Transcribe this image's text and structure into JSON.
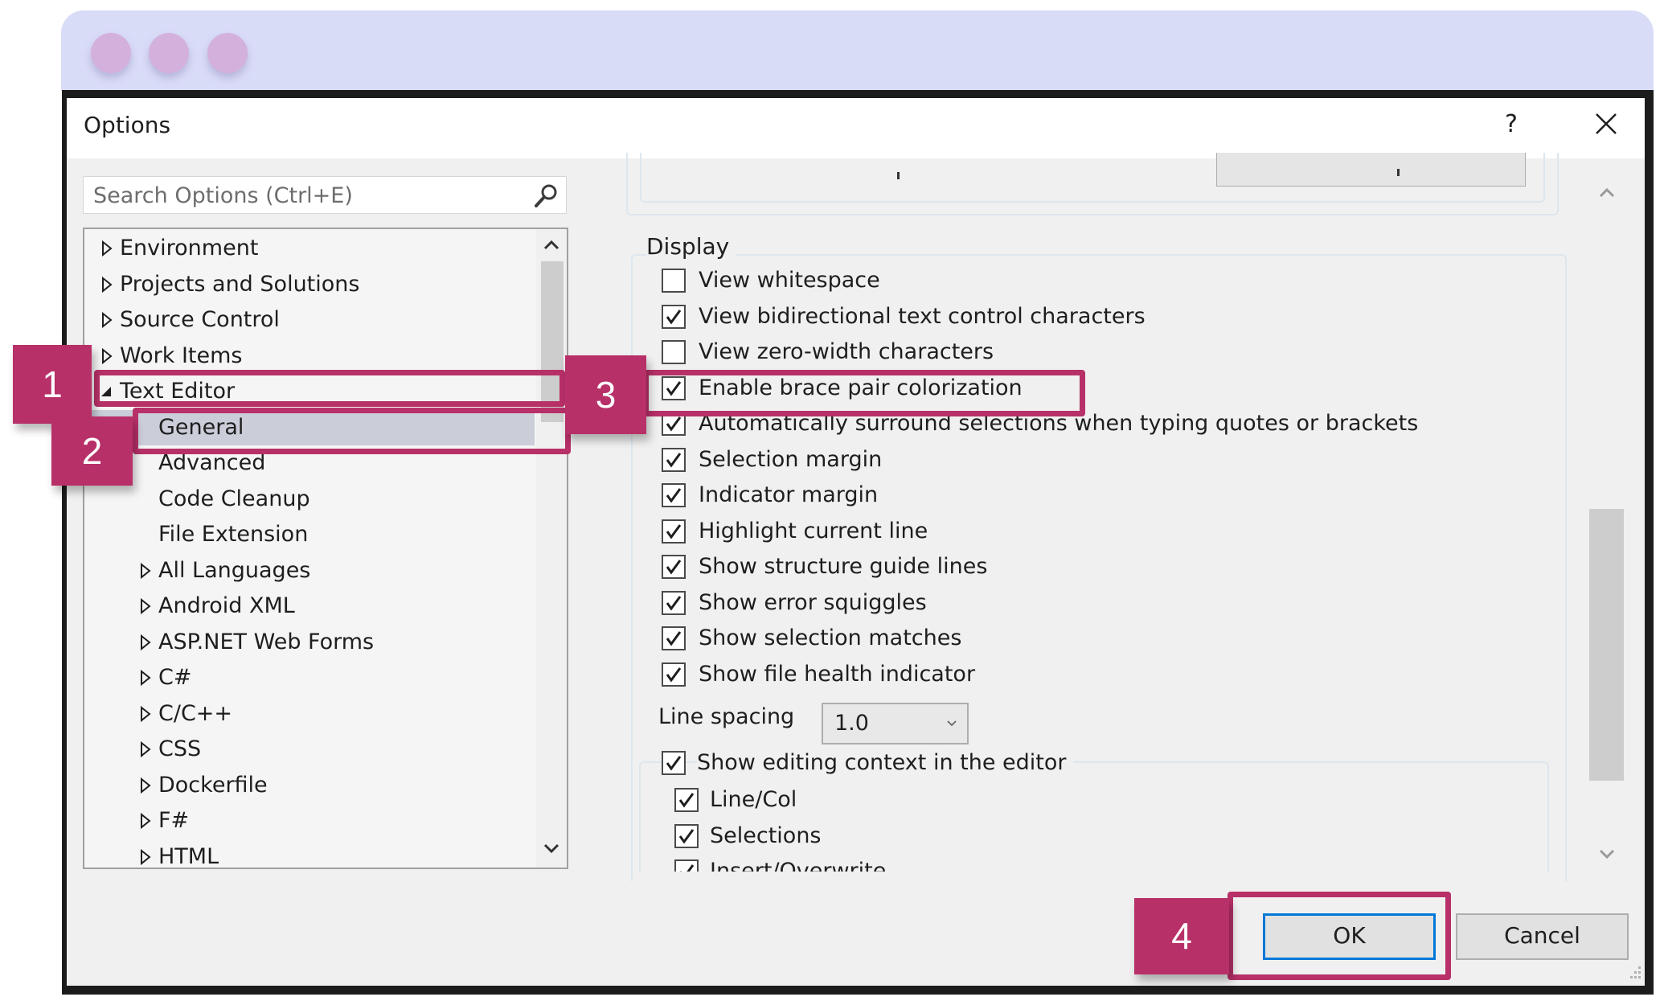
{
  "window": {
    "title": "Options",
    "help_label": "?",
    "close_icon": "close-icon"
  },
  "search": {
    "placeholder": "Search Options (Ctrl+E)",
    "icon": "search-icon"
  },
  "tree": {
    "items": [
      {
        "label": "Environment",
        "level": 0,
        "state": "collapsed"
      },
      {
        "label": "Projects and Solutions",
        "level": 0,
        "state": "collapsed"
      },
      {
        "label": "Source Control",
        "level": 0,
        "state": "collapsed"
      },
      {
        "label": "Work Items",
        "level": 0,
        "state": "collapsed"
      },
      {
        "label": "Text Editor",
        "level": 0,
        "state": "expanded"
      },
      {
        "label": "General",
        "level": 1,
        "state": "leaf",
        "selected": true
      },
      {
        "label": "Advanced",
        "level": 1,
        "state": "leaf"
      },
      {
        "label": "Code Cleanup",
        "level": 1,
        "state": "leaf"
      },
      {
        "label": "File Extension",
        "level": 1,
        "state": "leaf"
      },
      {
        "label": "All Languages",
        "level": 1,
        "state": "collapsed"
      },
      {
        "label": "Android XML",
        "level": 1,
        "state": "collapsed"
      },
      {
        "label": "ASP.NET Web Forms",
        "level": 1,
        "state": "collapsed"
      },
      {
        "label": "C#",
        "level": 1,
        "state": "collapsed"
      },
      {
        "label": "C/C++",
        "level": 1,
        "state": "collapsed"
      },
      {
        "label": "CSS",
        "level": 1,
        "state": "collapsed"
      },
      {
        "label": "Dockerfile",
        "level": 1,
        "state": "collapsed"
      },
      {
        "label": "F#",
        "level": 1,
        "state": "collapsed"
      },
      {
        "label": "HTML",
        "level": 1,
        "state": "collapsed"
      }
    ]
  },
  "display": {
    "group_label": "Display",
    "options": [
      {
        "label": "View whitespace",
        "checked": false
      },
      {
        "label": "View bidirectional text control characters",
        "checked": true
      },
      {
        "label": "View zero-width characters",
        "checked": false
      },
      {
        "label": "Enable brace pair colorization",
        "checked": true
      },
      {
        "label": "Automatically surround selections when typing quotes or brackets",
        "checked": true
      },
      {
        "label": "Selection margin",
        "checked": true
      },
      {
        "label": "Indicator margin",
        "checked": true
      },
      {
        "label": "Highlight current line",
        "checked": true
      },
      {
        "label": "Show structure guide lines",
        "checked": true
      },
      {
        "label": "Show error squiggles",
        "checked": true
      },
      {
        "label": "Show selection matches",
        "checked": true
      },
      {
        "label": "Show file health indicator",
        "checked": true
      }
    ],
    "line_spacing": {
      "label": "Line spacing",
      "value": "1.0"
    },
    "editing_context": {
      "label": "Show editing context in the editor",
      "checked": true
    },
    "editing_context_options": [
      {
        "label": "Line/Col",
        "checked": true
      },
      {
        "label": "Selections",
        "checked": true
      },
      {
        "label": "Insert/Overwrite",
        "checked": true
      }
    ]
  },
  "buttons": {
    "ok": "OK",
    "cancel": "Cancel"
  },
  "annotations": [
    {
      "number": "1",
      "target": "Text Editor"
    },
    {
      "number": "2",
      "target": "General"
    },
    {
      "number": "3",
      "target": "Enable brace pair colorization"
    },
    {
      "number": "4",
      "target": "OK"
    }
  ],
  "colors": {
    "annotation": "#b83068",
    "frame_titlebar": "#d9dcf7",
    "traffic_dot": "#d4b0dc",
    "ok_focus": "#0078d7",
    "selected_row": "#cbcdd9"
  }
}
